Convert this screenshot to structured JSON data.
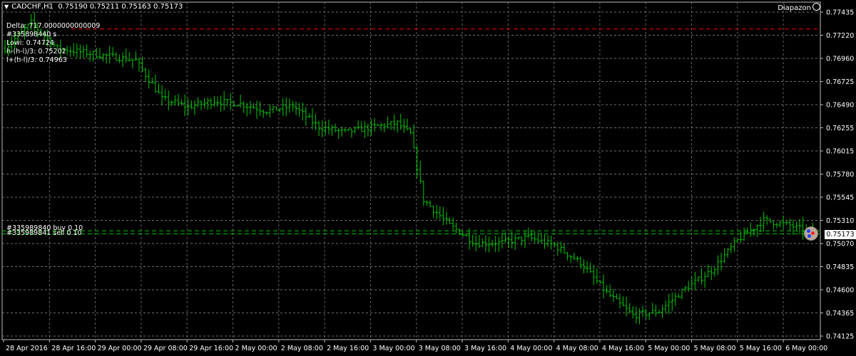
{
  "header": {
    "symbol": "CADCHF,H1",
    "ohlc": "0.75190 0.75211 0.75163 0.75173",
    "brand": "Diapazon"
  },
  "info_lines": [
    "Delta: 717.0000000000009",
    "#335898440 s",
    "Lowi: 0.74724",
    "h-(h-l)/3: 0.75202",
    "l+(h-l)/3: 0.74963"
  ],
  "order_labels": [
    "#335989840 buy 0.10",
    "#335989841 sell 0.10"
  ],
  "current_price_label": "0.75173",
  "colors": {
    "background": "#000000",
    "grid": "#6e6e6e",
    "candles": "#00c800",
    "order_line": "#00c800",
    "resistance_line": "#ff0000",
    "price_tag": "#ffffff"
  },
  "chart_data": {
    "type": "candlestick-bars",
    "timeframe": "H1",
    "ylim": [
      0.74125,
      0.77435
    ],
    "y_ticks": [
      "0.77435",
      "0.77220",
      "0.76960",
      "0.76725",
      "0.76490",
      "0.76255",
      "0.76015",
      "0.75780",
      "0.75545",
      "0.75310",
      "0.75070",
      "0.74835",
      "0.74600",
      "0.74365",
      "0.74125"
    ],
    "x_ticks": [
      "28 Apr 2016",
      "28 Apr 16:00",
      "29 Apr 00:00",
      "29 Apr 08:00",
      "29 Apr 16:00",
      "2 May 00:00",
      "2 May 08:00",
      "2 May 16:00",
      "3 May 00:00",
      "3 May 08:00",
      "3 May 16:00",
      "4 May 00:00",
      "4 May 08:00",
      "4 May 16:00",
      "5 May 00:00",
      "5 May 08:00",
      "5 May 16:00",
      "6 May 00:00"
    ],
    "horizontal_lines": [
      {
        "kind": "resistance",
        "value": 0.7719,
        "style": "dashed"
      },
      {
        "kind": "order",
        "value": 0.75195,
        "style": "dashed"
      },
      {
        "kind": "order",
        "value": 0.75165,
        "style": "dashed"
      }
    ],
    "close_points": [
      [
        0,
        0.77
      ],
      [
        8,
        0.7725
      ],
      [
        16,
        0.77
      ],
      [
        24,
        0.7696
      ],
      [
        32,
        0.7692
      ],
      [
        40,
        0.7688
      ],
      [
        48,
        0.765
      ],
      [
        56,
        0.7642
      ],
      [
        64,
        0.7648
      ],
      [
        72,
        0.7645
      ],
      [
        80,
        0.7638
      ],
      [
        88,
        0.7643
      ],
      [
        96,
        0.7622
      ],
      [
        104,
        0.7617
      ],
      [
        112,
        0.7622
      ],
      [
        120,
        0.7626
      ],
      [
        124,
        0.7615
      ],
      [
        128,
        0.755
      ],
      [
        136,
        0.7525
      ],
      [
        144,
        0.7507
      ],
      [
        152,
        0.7508
      ],
      [
        160,
        0.7513
      ],
      [
        168,
        0.7505
      ],
      [
        176,
        0.7488
      ],
      [
        184,
        0.7458
      ],
      [
        192,
        0.7436
      ],
      [
        200,
        0.744
      ],
      [
        208,
        0.7462
      ],
      [
        216,
        0.748
      ],
      [
        224,
        0.751
      ],
      [
        232,
        0.753
      ],
      [
        240,
        0.7525
      ],
      [
        247,
        0.7517
      ]
    ],
    "bar_count": 248
  }
}
